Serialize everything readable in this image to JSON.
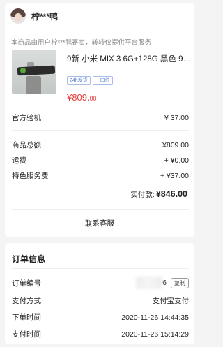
{
  "seller": {
    "name": "柠***鸭"
  },
  "notice": "本商品由用户柠***鸭寄卖，转转仅提供平台服务",
  "product": {
    "title": "9新 小米 MIX 3 6G+128G  黑色  9…",
    "tags": [
      "24h发货",
      "一口价"
    ],
    "price_int": "¥809.",
    "price_dec": "00"
  },
  "inspection": {
    "label": "官方验机",
    "value": "¥ 37.00"
  },
  "amounts": [
    {
      "label": "商品总额",
      "value": "¥809.00"
    },
    {
      "label": "运费",
      "value": "+ ¥0.00"
    },
    {
      "label": "特色服务费",
      "value": "+ ¥37.00"
    }
  ],
  "total": {
    "label": "实付款:",
    "value": "¥846.00"
  },
  "service_label": "联系客服",
  "order_info": {
    "title": "订单信息",
    "number_label": "订单编号",
    "number_suffix": "6",
    "copy_label": "复制",
    "pay_method_label": "支付方式",
    "pay_method_value": "支付宝支付",
    "order_time_label": "下单时间",
    "order_time_value": "2020-11-26 14:44:35",
    "pay_time_label": "支付时间",
    "pay_time_value": "2020-11-26 15:14:29"
  }
}
